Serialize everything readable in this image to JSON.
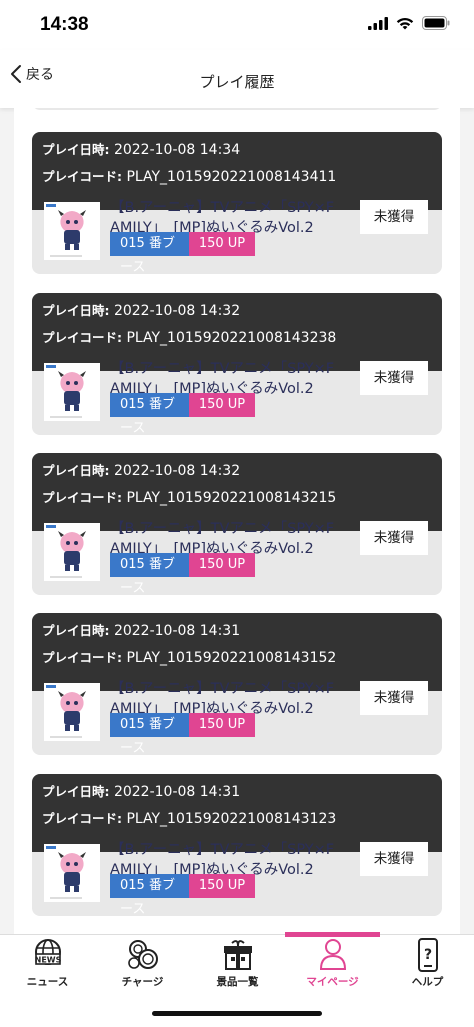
{
  "status_bar": {
    "time": "14:38"
  },
  "nav": {
    "back_label": "戻る",
    "title": "プレイ履歴"
  },
  "labels": {
    "play_date": "プレイ日時:",
    "play_code": "プレイコード:"
  },
  "history": [
    {
      "date": "2022-10-08 14:34",
      "code": "PLAY_1015920221008143411",
      "product_line1": "【B.アーニャ】TVアニメ「SPY×F",
      "product_line2": "AMILY」　[MP]ぬいぐるみVol.2",
      "booth": "015 番ブース",
      "points": "150 UP",
      "status": "未獲得"
    },
    {
      "date": "2022-10-08 14:32",
      "code": "PLAY_1015920221008143238",
      "product_line1": "【B.アーニャ】TVアニメ「SPY×F",
      "product_line2": "AMILY」　[MP]ぬいぐるみVol.2",
      "booth": "015 番ブース",
      "points": "150 UP",
      "status": "未獲得"
    },
    {
      "date": "2022-10-08 14:32",
      "code": "PLAY_1015920221008143215",
      "product_line1": "【B.アーニャ】TVアニメ「SPY×F",
      "product_line2": "AMILY」　[MP]ぬいぐるみVol.2",
      "booth": "015 番ブース",
      "points": "150 UP",
      "status": "未獲得"
    },
    {
      "date": "2022-10-08 14:31",
      "code": "PLAY_1015920221008143152",
      "product_line1": "【B.アーニャ】TVアニメ「SPY×F",
      "product_line2": "AMILY」　[MP]ぬいぐるみVol.2",
      "booth": "015 番ブース",
      "points": "150 UP",
      "status": "未獲得"
    },
    {
      "date": "2022-10-08 14:31",
      "code": "PLAY_1015920221008143123",
      "product_line1": "【B.アーニャ】TVアニメ「SPY×F",
      "product_line2": "AMILY」　[MP]ぬいぐるみVol.2",
      "booth": "015 番ブース",
      "points": "150 UP",
      "status": "未獲得"
    }
  ],
  "tabs": [
    {
      "label": "ニュース",
      "icon": "news-globe-icon"
    },
    {
      "label": "チャージ",
      "icon": "coins-icon"
    },
    {
      "label": "景品一覧",
      "icon": "gift-box-icon"
    },
    {
      "label": "マイページ",
      "icon": "user-icon",
      "active": true
    },
    {
      "label": "ヘルプ",
      "icon": "help-phone-icon"
    }
  ],
  "colors": {
    "accent": "#e04592",
    "booth_tag": "#3a78c9",
    "card_header": "#333333",
    "card_body": "#e8e8e8"
  }
}
